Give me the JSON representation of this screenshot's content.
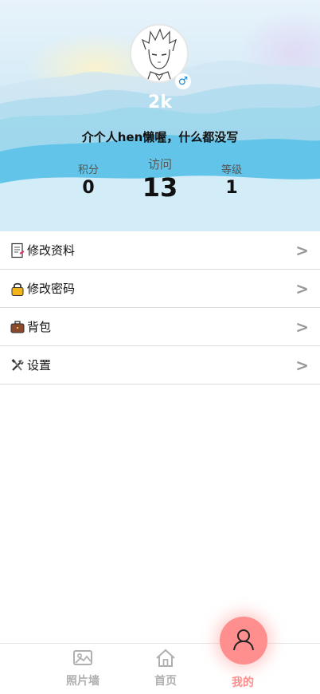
{
  "profile": {
    "nickname": "2k",
    "gender_symbol": "♂",
    "signature": "介个人hen懒喔，什么都没写"
  },
  "stats": [
    {
      "label": "积分",
      "value": "0"
    },
    {
      "label": "访问",
      "value": "13"
    },
    {
      "label": "等级",
      "value": "1"
    }
  ],
  "menu": [
    {
      "label": "修改资料",
      "icon": "document-icon",
      "arrow": ">"
    },
    {
      "label": "修改密码",
      "icon": "lock-icon",
      "arrow": ">"
    },
    {
      "label": "背包",
      "icon": "briefcase-icon",
      "arrow": ">"
    },
    {
      "label": "设置",
      "icon": "tools-icon",
      "arrow": ">"
    }
  ],
  "tabbar": {
    "tabs": [
      {
        "label": "照片墙",
        "icon": "photo-wall-icon"
      },
      {
        "label": "首页",
        "icon": "home-icon"
      },
      {
        "label": "我的",
        "icon": "user-icon",
        "active": true
      }
    ]
  },
  "colors": {
    "active_tab": "#ff8d8d",
    "fab": "#ff8f8f",
    "inactive_tab": "#b0b0b0",
    "gender": "#1a8cd8"
  }
}
